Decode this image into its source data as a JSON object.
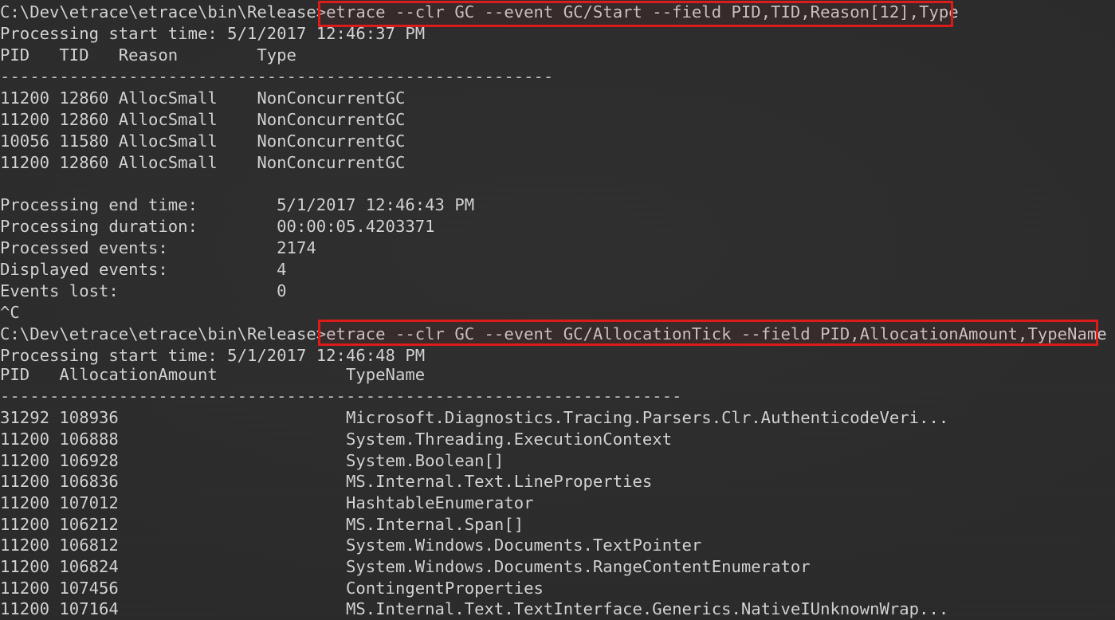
{
  "terminal": {
    "background_color": "#2b2b2b",
    "text_color": "#d4d4d4",
    "highlight_color": "#dd1a1a",
    "prompt": "C:\\Dev\\etrace\\etrace\\bin\\Release>",
    "separator_short": "--------------------------------------------------------",
    "separator_long": "---------------------------------------------------------------------"
  },
  "session_one": {
    "command": "etrace --clr GC --event GC/Start --field PID,TID,Reason[12],Type",
    "start_time_label": "Processing start time:",
    "start_time_value": "5/1/2017 12:46:37 PM",
    "start_time_line": "Processing start time: 5/1/2017 12:46:37 PM",
    "header_line": "PID   TID   Reason        Type",
    "columns": [
      "PID",
      "TID",
      "Reason",
      "Type"
    ],
    "rows": [
      "11200 12860 AllocSmall    NonConcurrentGC",
      "11200 12860 AllocSmall    NonConcurrentGC",
      "10056 11580 AllocSmall    NonConcurrentGC",
      "11200 12860 AllocSmall    NonConcurrentGC"
    ],
    "summary": [
      "Processing end time:        5/1/2017 12:46:43 PM",
      "Processing duration:        00:00:05.4203371",
      "Processed events:           2174",
      "Displayed events:           4",
      "Events lost:                0"
    ],
    "summary_fields": [
      {
        "label": "Processing end time:",
        "value": "5/1/2017 12:46:43 PM"
      },
      {
        "label": "Processing duration:",
        "value": "00:00:05.4203371"
      },
      {
        "label": "Processed events:",
        "value": "2174"
      },
      {
        "label": "Displayed events:",
        "value": "4"
      },
      {
        "label": "Events lost:",
        "value": "0"
      }
    ],
    "interrupt": "^C"
  },
  "session_two": {
    "command": "etrace --clr GC --event GC/AllocationTick --field PID,AllocationAmount,TypeName",
    "start_time_label": "Processing start time:",
    "start_time_value": "5/1/2017 12:46:48 PM",
    "start_time_line": "Processing start time: 5/1/2017 12:46:48 PM",
    "header_line": "PID   AllocationAmount             TypeName",
    "columns": [
      "PID",
      "AllocationAmount",
      "TypeName"
    ],
    "rows": [
      "31292 108936                       Microsoft.Diagnostics.Tracing.Parsers.Clr.AuthenticodeVeri...",
      "11200 106888                       System.Threading.ExecutionContext",
      "11200 106928                       System.Boolean[]",
      "11200 106836                       MS.Internal.Text.LineProperties",
      "11200 107012                       HashtableEnumerator",
      "11200 106212                       MS.Internal.Span[]",
      "11200 106812                       System.Windows.Documents.TextPointer",
      "11200 106824                       System.Windows.Documents.RangeContentEnumerator",
      "11200 107456                       ContingentProperties",
      "11200 107164                       MS.Internal.Text.TextInterface.Generics.NativeIUnknownWrap..."
    ]
  }
}
